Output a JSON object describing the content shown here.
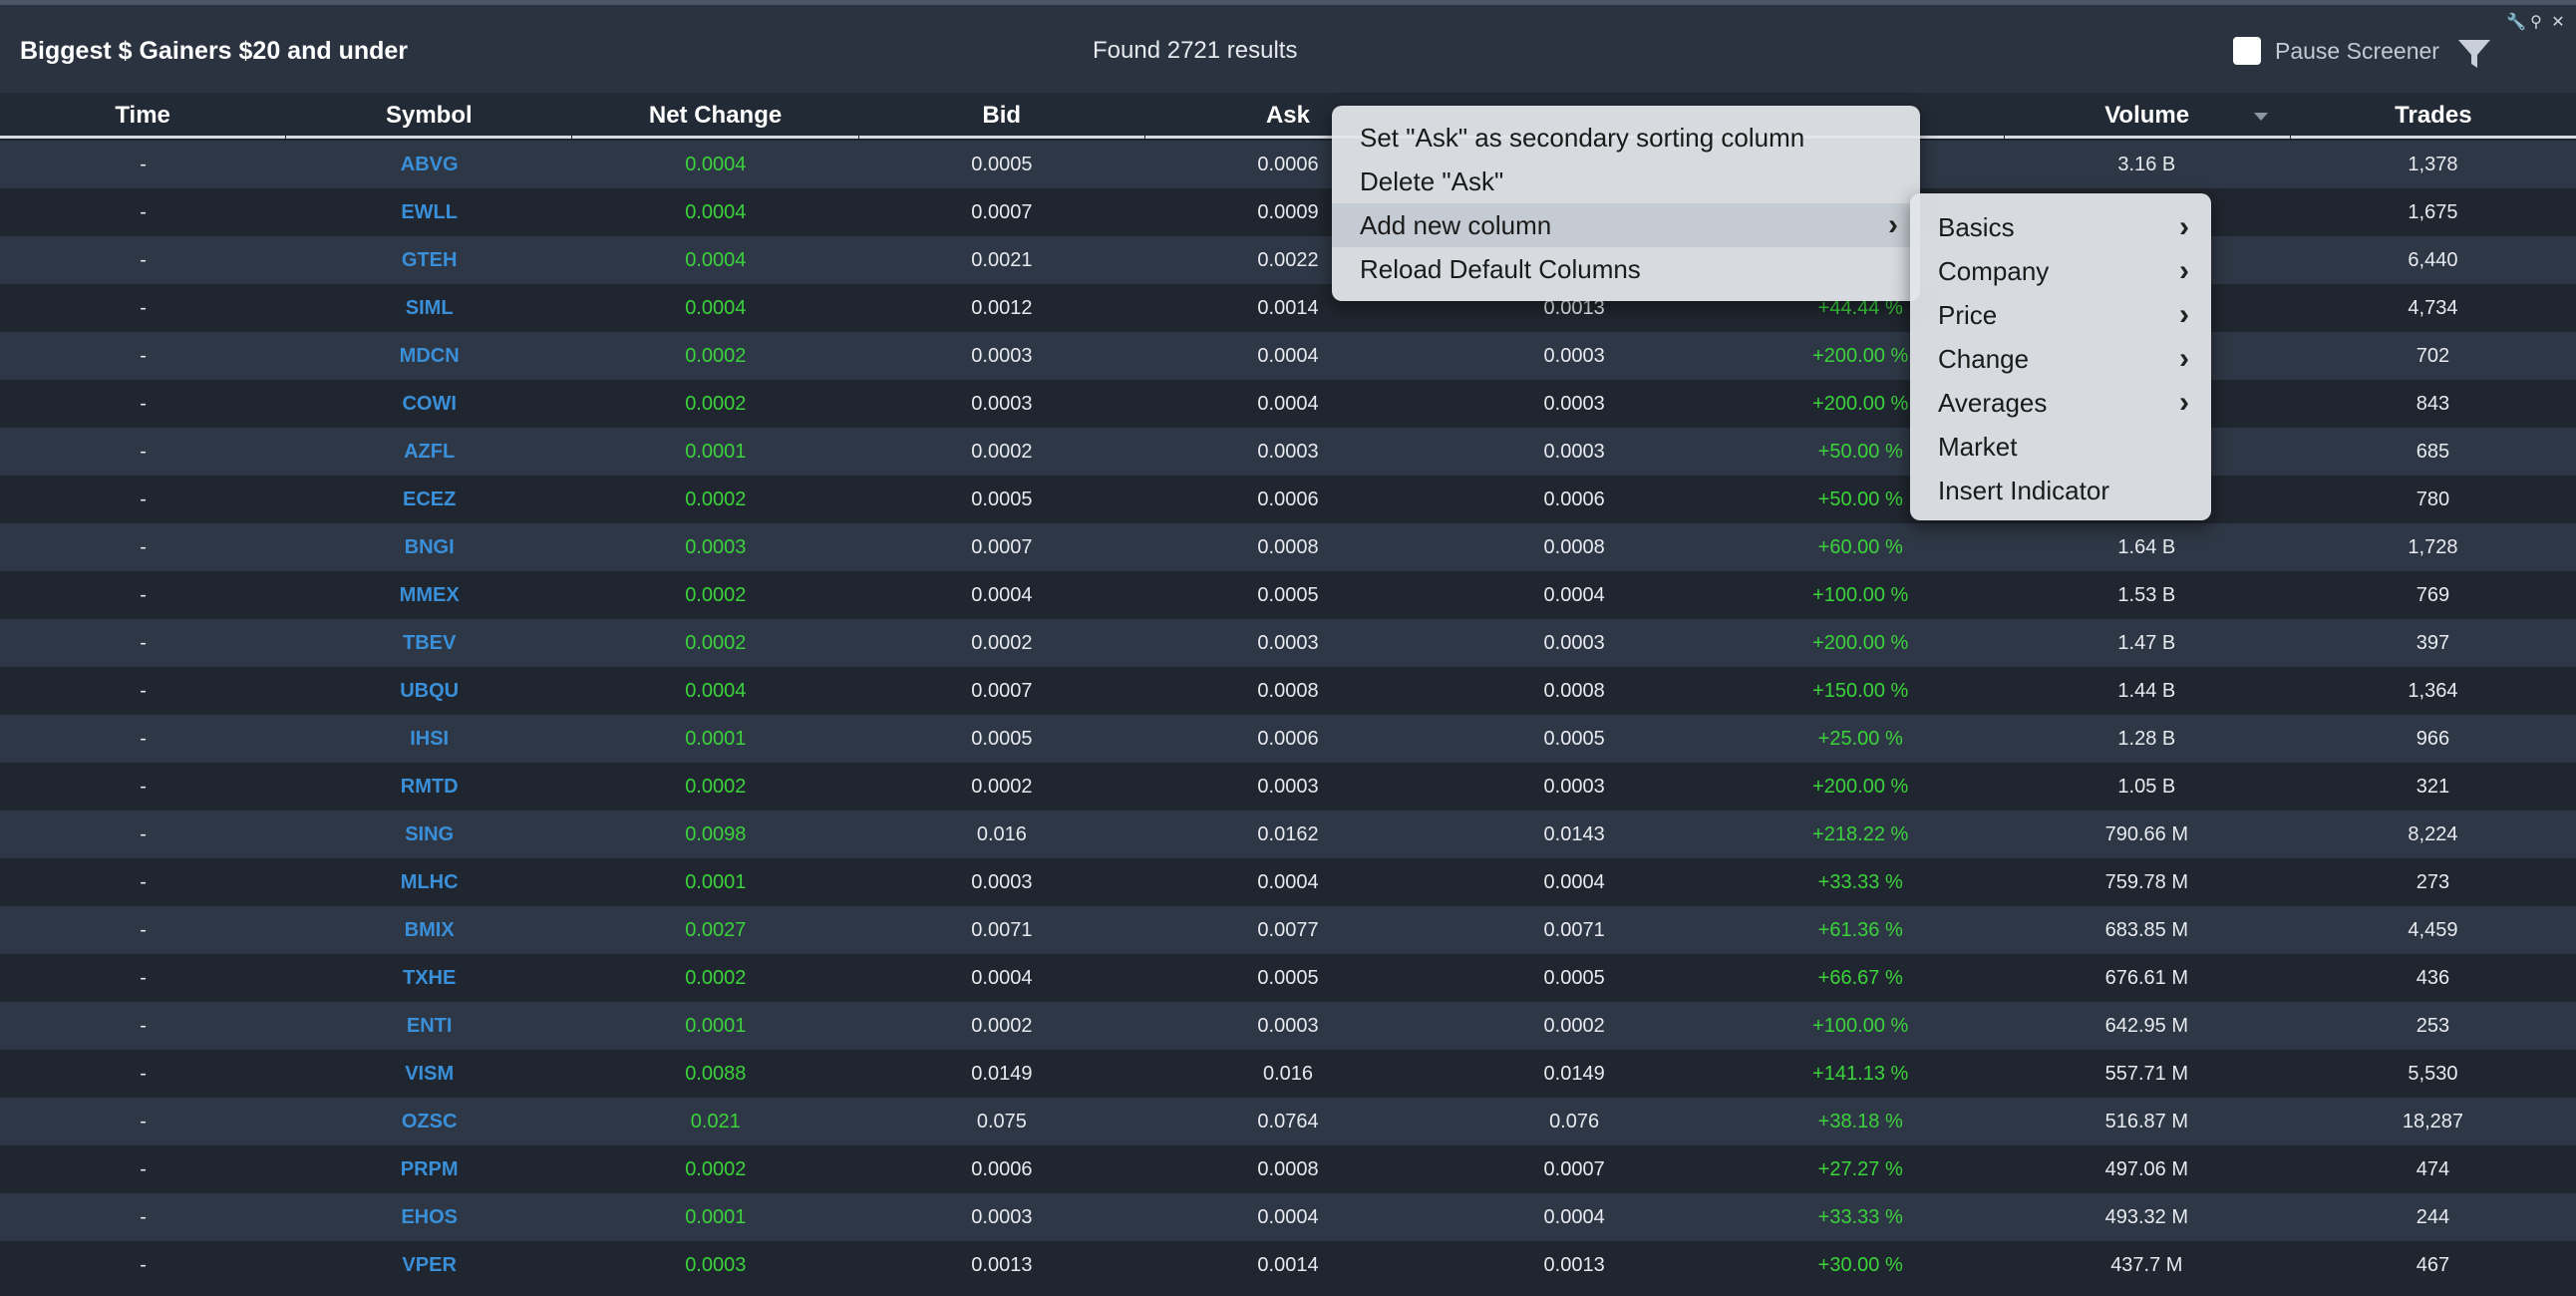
{
  "header": {
    "title": "Biggest $ Gainers $20 and under",
    "found": "Found 2721 results",
    "pause_label": "Pause Screener"
  },
  "columns": [
    "Time",
    "Symbol",
    "Net Change",
    "Bid",
    "Ask",
    "",
    "",
    "Volume",
    "Trades"
  ],
  "rows": [
    [
      "-",
      "ABVG",
      "0.0004",
      "0.0005",
      "0.0006",
      "",
      "",
      "3.16 B",
      "1,378"
    ],
    [
      "-",
      "EWLL",
      "0.0004",
      "0.0007",
      "0.0009",
      "",
      "",
      "",
      "1,675"
    ],
    [
      "-",
      "GTEH",
      "0.0004",
      "0.0021",
      "0.0022",
      "",
      "",
      "",
      "6,440"
    ],
    [
      "-",
      "SIML",
      "0.0004",
      "0.0012",
      "0.0014",
      "0.0013",
      "+44.44 %",
      "",
      "4,734"
    ],
    [
      "-",
      "MDCN",
      "0.0002",
      "0.0003",
      "0.0004",
      "0.0003",
      "+200.00 %",
      "",
      "702"
    ],
    [
      "-",
      "COWI",
      "0.0002",
      "0.0003",
      "0.0004",
      "0.0003",
      "+200.00 %",
      "",
      "843"
    ],
    [
      "-",
      "AZFL",
      "0.0001",
      "0.0002",
      "0.0003",
      "0.0003",
      "+50.00 %",
      "",
      "685"
    ],
    [
      "-",
      "ECEZ",
      "0.0002",
      "0.0005",
      "0.0006",
      "0.0006",
      "+50.00 %",
      "",
      "780"
    ],
    [
      "-",
      "BNGI",
      "0.0003",
      "0.0007",
      "0.0008",
      "0.0008",
      "+60.00 %",
      "1.64 B",
      "1,728"
    ],
    [
      "-",
      "MMEX",
      "0.0002",
      "0.0004",
      "0.0005",
      "0.0004",
      "+100.00 %",
      "1.53 B",
      "769"
    ],
    [
      "-",
      "TBEV",
      "0.0002",
      "0.0002",
      "0.0003",
      "0.0003",
      "+200.00 %",
      "1.47 B",
      "397"
    ],
    [
      "-",
      "UBQU",
      "0.0004",
      "0.0007",
      "0.0008",
      "0.0008",
      "+150.00 %",
      "1.44 B",
      "1,364"
    ],
    [
      "-",
      "IHSI",
      "0.0001",
      "0.0005",
      "0.0006",
      "0.0005",
      "+25.00 %",
      "1.28 B",
      "966"
    ],
    [
      "-",
      "RMTD",
      "0.0002",
      "0.0002",
      "0.0003",
      "0.0003",
      "+200.00 %",
      "1.05 B",
      "321"
    ],
    [
      "-",
      "SING",
      "0.0098",
      "0.016",
      "0.0162",
      "0.0143",
      "+218.22 %",
      "790.66 M",
      "8,224"
    ],
    [
      "-",
      "MLHC",
      "0.0001",
      "0.0003",
      "0.0004",
      "0.0004",
      "+33.33 %",
      "759.78 M",
      "273"
    ],
    [
      "-",
      "BMIX",
      "0.0027",
      "0.0071",
      "0.0077",
      "0.0071",
      "+61.36 %",
      "683.85 M",
      "4,459"
    ],
    [
      "-",
      "TXHE",
      "0.0002",
      "0.0004",
      "0.0005",
      "0.0005",
      "+66.67 %",
      "676.61 M",
      "436"
    ],
    [
      "-",
      "ENTI",
      "0.0001",
      "0.0002",
      "0.0003",
      "0.0002",
      "+100.00 %",
      "642.95 M",
      "253"
    ],
    [
      "-",
      "VISM",
      "0.0088",
      "0.0149",
      "0.016",
      "0.0149",
      "+141.13 %",
      "557.71 M",
      "5,530"
    ],
    [
      "-",
      "OZSC",
      "0.021",
      "0.075",
      "0.0764",
      "0.076",
      "+38.18 %",
      "516.87 M",
      "18,287"
    ],
    [
      "-",
      "PRPM",
      "0.0002",
      "0.0006",
      "0.0008",
      "0.0007",
      "+27.27 %",
      "497.06 M",
      "474"
    ],
    [
      "-",
      "EHOS",
      "0.0001",
      "0.0003",
      "0.0004",
      "0.0004",
      "+33.33 %",
      "493.32 M",
      "244"
    ],
    [
      "-",
      "VPER",
      "0.0003",
      "0.0013",
      "0.0014",
      "0.0013",
      "+30.00 %",
      "437.7 M",
      "467"
    ]
  ],
  "context_menu": {
    "items": [
      "Set \"Ask\" as secondary sorting column",
      "Delete \"Ask\"",
      "Add new column",
      "Reload Default Columns"
    ]
  },
  "submenu": {
    "items": [
      {
        "label": "Basics",
        "has_arrow": true
      },
      {
        "label": "Company",
        "has_arrow": true
      },
      {
        "label": "Price",
        "has_arrow": true
      },
      {
        "label": "Change",
        "has_arrow": true
      },
      {
        "label": "Averages",
        "has_arrow": true
      },
      {
        "label": "Market",
        "has_arrow": false
      },
      {
        "label": "Insert Indicator",
        "has_arrow": false
      }
    ]
  },
  "icons": {
    "filter": "filter-icon",
    "wrench": "wrench-icon",
    "popout": "popout-icon",
    "close": "close-icon",
    "chevron": "chevron-right-icon"
  },
  "colors": {
    "symbol": "#3a8fd9",
    "positive": "#3cd23c",
    "row_odd": "#2e3745",
    "row_even": "#20262f"
  }
}
